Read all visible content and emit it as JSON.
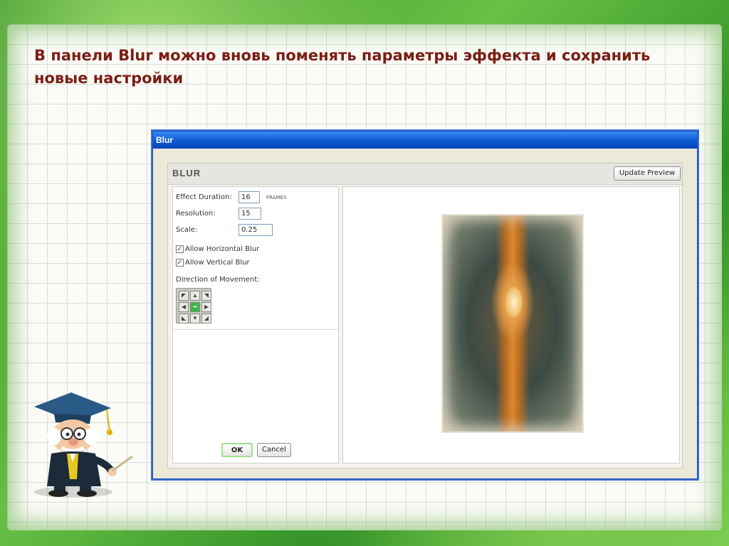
{
  "slide": {
    "title": "В панели Blur можно вновь поменять параметры эффекта и сохранить новые настройки"
  },
  "dialog": {
    "window_title": "Blur",
    "panel_title": "BLUR",
    "update_preview_label": "Update Preview",
    "effect_duration_label": "Effect Duration:",
    "effect_duration_value": "16",
    "effect_duration_unit": "FRAMES",
    "resolution_label": "Resolution:",
    "resolution_value": "15",
    "scale_label": "Scale:",
    "scale_value": "0.25",
    "allow_horizontal_label": "Allow Horizontal Blur",
    "allow_horizontal_checked": true,
    "allow_vertical_label": "Allow Vertical Blur",
    "allow_vertical_checked": true,
    "direction_label": "Direction of Movement:",
    "direction_selected": "center",
    "ok_label": "OK",
    "cancel_label": "Cancel"
  },
  "colors": {
    "title_color": "#7a1e14",
    "frame_green": "#3f9a2a",
    "titlebar_blue": "#0a54d0",
    "selected_direction": "#39b54a"
  },
  "icons": {
    "check": "checkmark-icon",
    "arrows": [
      "arrow-up-left-icon",
      "arrow-up-icon",
      "arrow-up-right-icon",
      "arrow-left-icon",
      "center-icon",
      "arrow-right-icon",
      "arrow-down-left-icon",
      "arrow-down-icon",
      "arrow-down-right-icon"
    ]
  }
}
